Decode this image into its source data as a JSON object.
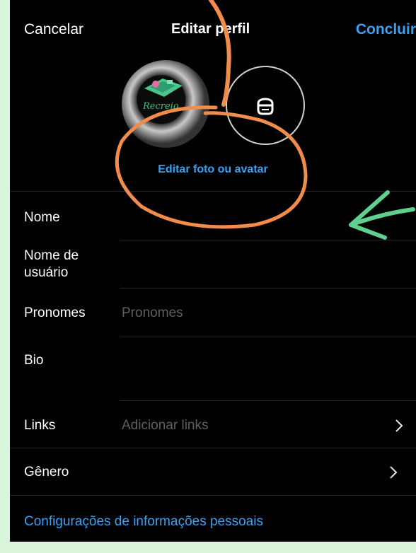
{
  "nav": {
    "cancel_label": "Cancelar",
    "title": "Editar perfil",
    "done_label": "Concluir"
  },
  "profile": {
    "logo_text": "Recreio",
    "edit_photo_label": "Editar foto ou avatar"
  },
  "fields": {
    "name_label": "Nome",
    "username_label": "Nome de\nusuário",
    "pronouns_label": "Pronomes",
    "pronouns_placeholder": "Pronomes",
    "bio_label": "Bio",
    "links_label": "Links",
    "links_placeholder": "Adicionar links",
    "gender_label": "Gênero"
  },
  "footer": {
    "personal_info_link": "Configurações de informações pessoais"
  },
  "colors": {
    "page_background": "#d9f5dc",
    "screen_background": "#000000",
    "accent_link": "#3aa0f3",
    "annotation_orange": "#f28c4b",
    "annotation_green": "#5ed18e"
  },
  "icons": {
    "avatar": "avatar-face-icon",
    "chevron": "chevron-right-icon"
  }
}
